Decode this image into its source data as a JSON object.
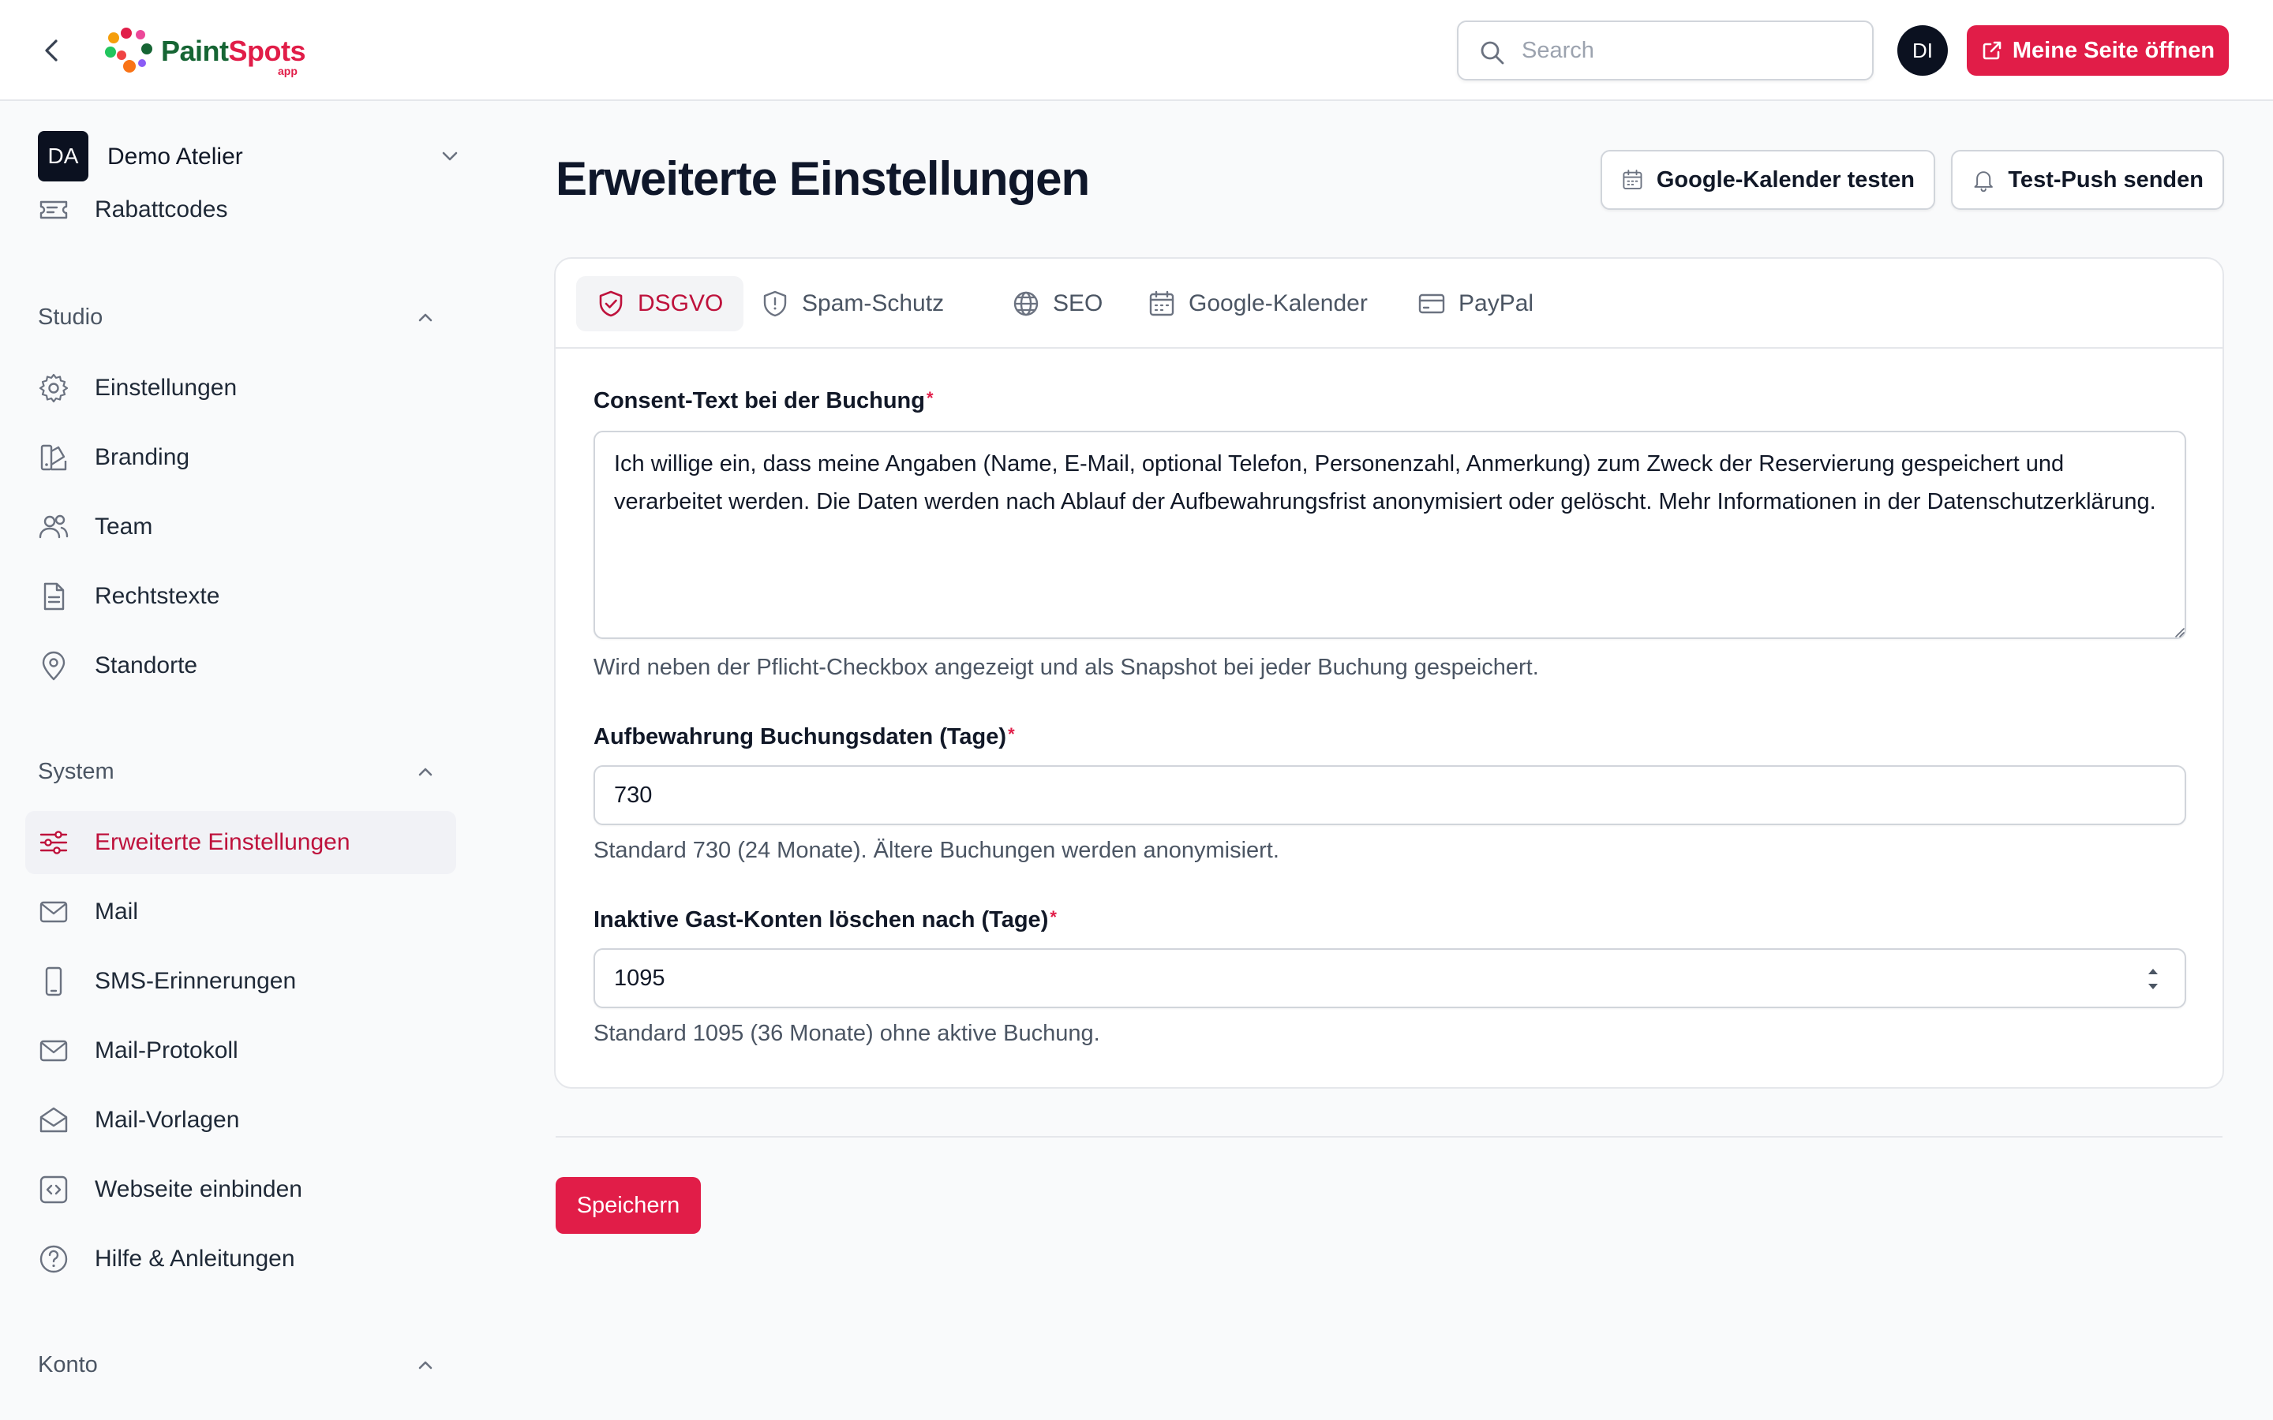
{
  "header": {
    "logo_text_1": "Paint",
    "logo_text_2": "Spots",
    "logo_sub": "app",
    "search_placeholder": "Search",
    "user_initials": "DI",
    "open_site_label": "Meine Seite öffnen"
  },
  "sidebar": {
    "team": {
      "initials": "DA",
      "name": "Demo Atelier"
    },
    "top_items": [
      {
        "label": "Rabattcodes",
        "icon": "ticket-icon"
      }
    ],
    "groups": [
      {
        "label": "Studio",
        "items": [
          {
            "label": "Einstellungen",
            "icon": "gear-icon"
          },
          {
            "label": "Branding",
            "icon": "palette-icon"
          },
          {
            "label": "Team",
            "icon": "users-icon"
          },
          {
            "label": "Rechtstexte",
            "icon": "document-icon"
          },
          {
            "label": "Standorte",
            "icon": "map-pin-icon"
          }
        ]
      },
      {
        "label": "System",
        "items": [
          {
            "label": "Erweiterte Einstellungen",
            "icon": "sliders-icon",
            "active": true
          },
          {
            "label": "Mail",
            "icon": "envelope-icon"
          },
          {
            "label": "SMS-Erinnerungen",
            "icon": "phone-icon"
          },
          {
            "label": "Mail-Protokoll",
            "icon": "envelope-icon"
          },
          {
            "label": "Mail-Vorlagen",
            "icon": "envelope-open-icon"
          },
          {
            "label": "Webseite einbinden",
            "icon": "code-icon"
          },
          {
            "label": "Hilfe & Anleitungen",
            "icon": "help-circle-icon"
          }
        ]
      },
      {
        "label": "Konto",
        "items": []
      }
    ]
  },
  "main": {
    "title": "Erweiterte Einstellungen",
    "actions": {
      "test_calendar": "Google-Kalender testen",
      "test_push": "Test-Push senden"
    },
    "tabs": [
      {
        "label": "DSGVO",
        "icon": "shield-check-icon",
        "active": true
      },
      {
        "label": "Spam-Schutz",
        "icon": "shield-icon"
      },
      {
        "label": "SEO",
        "icon": "globe-icon"
      },
      {
        "label": "Google-Kalender",
        "icon": "calendar-icon"
      },
      {
        "label": "PayPal",
        "icon": "credit-card-icon"
      }
    ],
    "form": {
      "consent": {
        "label": "Consent-Text bei der Buchung",
        "required_mark": "*",
        "value": "Ich willige ein, dass meine Angaben (Name, E-Mail, optional Telefon, Personenzahl, Anmerkung) zum Zweck der Reservierung gespeichert und verarbeitet werden. Die Daten werden nach Ablauf der Aufbewahrungsfrist anonymisiert oder gelöscht. Mehr Informationen in der Datenschutzerklärung.",
        "hint": "Wird neben der Pflicht-Checkbox angezeigt und als Snapshot bei jeder Buchung gespeichert."
      },
      "retention": {
        "label": "Aufbewahrung Buchungsdaten (Tage)",
        "required_mark": "*",
        "value": "730",
        "hint": "Standard 730 (24 Monate). Ältere Buchungen werden anonymisiert."
      },
      "guest_delete": {
        "label": "Inaktive Gast-Konten löschen nach (Tage)",
        "required_mark": "*",
        "value": "1095",
        "hint": "Standard 1095 (36 Monate) ohne aktive Buchung."
      }
    },
    "save_label": "Speichern"
  },
  "colors": {
    "accent": "#e11d48",
    "active_text": "#be123c",
    "dark_avatar": "#0b1120"
  }
}
